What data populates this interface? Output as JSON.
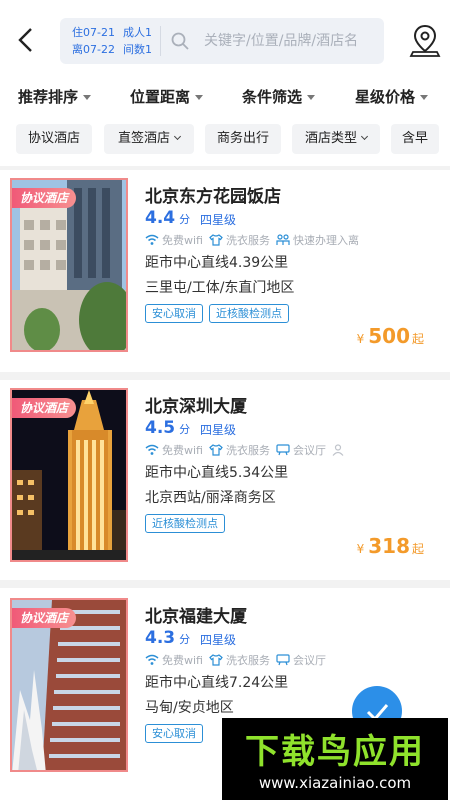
{
  "header": {
    "checkin": "住07-21",
    "adults": "成人1",
    "checkout": "离07-22",
    "rooms": "间数1",
    "search_placeholder": "关键字/位置/品牌/酒店名"
  },
  "sort_bar": [
    {
      "label": "推荐排序"
    },
    {
      "label": "位置距离"
    },
    {
      "label": "条件筛选"
    },
    {
      "label": "星级价格"
    }
  ],
  "chips": [
    {
      "label": "协议酒店"
    },
    {
      "label": "直签酒店"
    },
    {
      "label": "商务出行"
    },
    {
      "label": "酒店类型"
    },
    {
      "label": "含早"
    }
  ],
  "colors": {
    "accent": "#2c6fe0",
    "price": "#f39a2a",
    "ribbon": "#f05a78"
  },
  "hotels": [
    {
      "ribbon": "协议酒店",
      "name": "北京东方花园饭店",
      "score": "4.4",
      "score_unit": "分",
      "star": "四星级",
      "facilities": [
        "免费wifi",
        "洗衣服务",
        "快速办理入离"
      ],
      "distance": "距市中心直线4.39公里",
      "area": "三里屯/工体/东直门地区",
      "tags": [
        "安心取消",
        "近核酸检测点"
      ],
      "currency": "¥",
      "price": "500",
      "price_suffix": "起"
    },
    {
      "ribbon": "协议酒店",
      "name": "北京深圳大厦",
      "score": "4.5",
      "score_unit": "分",
      "star": "四星级",
      "facilities": [
        "免费wifi",
        "洗衣服务",
        "会议厅"
      ],
      "distance": "距市中心直线5.34公里",
      "area": "北京西站/丽泽商务区",
      "tags": [
        "近核酸检测点"
      ],
      "currency": "¥",
      "price": "318",
      "price_suffix": "起"
    },
    {
      "ribbon": "协议酒店",
      "name": "北京福建大厦",
      "score": "4.3",
      "score_unit": "分",
      "star": "四星级",
      "facilities": [
        "免费wifi",
        "洗衣服务",
        "会议厅"
      ],
      "distance": "距市中心直线7.24公里",
      "area": "马甸/安贞地区",
      "tags": [
        "安心取消"
      ]
    }
  ],
  "watermark": {
    "title": "下载鸟应用",
    "url": "www.xiazainiao.com"
  }
}
